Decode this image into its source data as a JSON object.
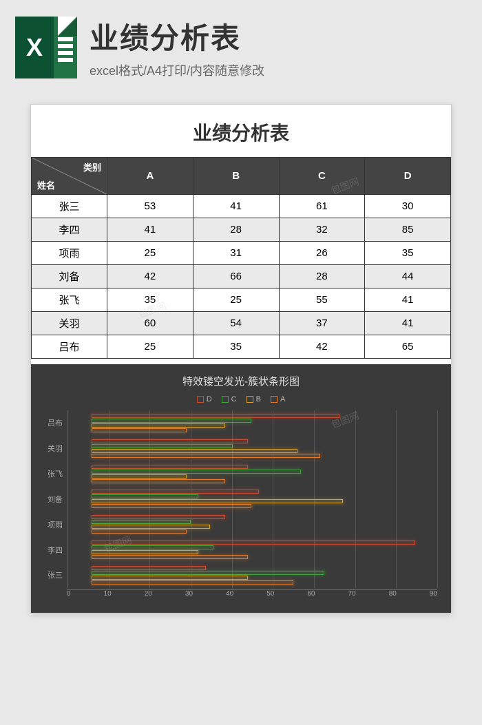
{
  "header": {
    "title": "业绩分析表",
    "subtitle": "excel格式/A4打印/内容随意修改"
  },
  "sheet": {
    "title": "业绩分析表",
    "diag_top": "类别",
    "diag_bottom": "姓名",
    "columns": [
      "A",
      "B",
      "C",
      "D"
    ],
    "rows": [
      {
        "name": "张三",
        "A": 53,
        "B": 41,
        "C": 61,
        "D": 30
      },
      {
        "name": "李四",
        "A": 41,
        "B": 28,
        "C": 32,
        "D": 85
      },
      {
        "name": "项雨",
        "A": 25,
        "B": 31,
        "C": 26,
        "D": 35
      },
      {
        "name": "刘备",
        "A": 42,
        "B": 66,
        "C": 28,
        "D": 44
      },
      {
        "name": "张飞",
        "A": 35,
        "B": 25,
        "C": 55,
        "D": 41
      },
      {
        "name": "关羽",
        "A": 60,
        "B": 54,
        "C": 37,
        "D": 41
      },
      {
        "name": "吕布",
        "A": 25,
        "B": 35,
        "C": 42,
        "D": 65
      }
    ]
  },
  "chart_data": {
    "type": "bar",
    "title": "特效镂空发光-簇状条形图",
    "orientation": "horizontal",
    "categories": [
      "吕布",
      "关羽",
      "张飞",
      "刘备",
      "项雨",
      "李四",
      "张三"
    ],
    "series": [
      {
        "name": "D",
        "values": [
          65,
          41,
          41,
          44,
          35,
          85,
          30
        ],
        "color": "#d1482e"
      },
      {
        "name": "C",
        "values": [
          42,
          37,
          55,
          28,
          26,
          32,
          61
        ],
        "color": "#3fa63f"
      },
      {
        "name": "B",
        "values": [
          35,
          54,
          25,
          66,
          31,
          28,
          41
        ],
        "color": "#d9a22b"
      },
      {
        "name": "A",
        "values": [
          25,
          60,
          35,
          42,
          25,
          41,
          53
        ],
        "color": "#e07b2e"
      }
    ],
    "xlim": [
      0,
      90
    ],
    "xticks": [
      0,
      10,
      20,
      30,
      40,
      50,
      60,
      70,
      80,
      90
    ],
    "legend_order": [
      "D",
      "C",
      "B",
      "A"
    ]
  }
}
